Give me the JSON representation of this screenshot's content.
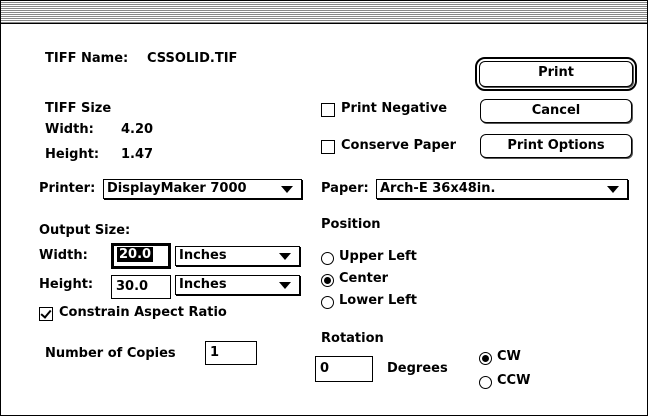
{
  "tiff": {
    "name_label": "TIFF Name:",
    "name_value": "CSSOLID.TIF",
    "size_label": "TIFF Size",
    "width_label": "Width:",
    "width_value": "4.20",
    "height_label": "Height:",
    "height_value": "1.47"
  },
  "buttons": {
    "print": "Print",
    "cancel": "Cancel",
    "print_options": "Print Options"
  },
  "checks": {
    "print_negative": "Print Negative",
    "conserve_paper": "Conserve Paper",
    "constrain": "Constrain Aspect Ratio"
  },
  "printer": {
    "label": "Printer:",
    "value": "DisplayMaker 7000"
  },
  "paper": {
    "label": "Paper:",
    "value": "Arch-E 36x48in."
  },
  "output": {
    "label": "Output Size:",
    "width_label": "Width:",
    "width_value": "20.0",
    "width_unit": "Inches",
    "height_label": "Height:",
    "height_value": "30.0",
    "height_unit": "Inches"
  },
  "position": {
    "label": "Position",
    "upper_left": "Upper Left",
    "center": "Center",
    "lower_left": "Lower Left"
  },
  "copies": {
    "label": "Number of Copies",
    "value": "1"
  },
  "rotation": {
    "label": "Rotation",
    "value": "0",
    "degrees": "Degrees",
    "cw": "CW",
    "ccw": "CCW"
  }
}
